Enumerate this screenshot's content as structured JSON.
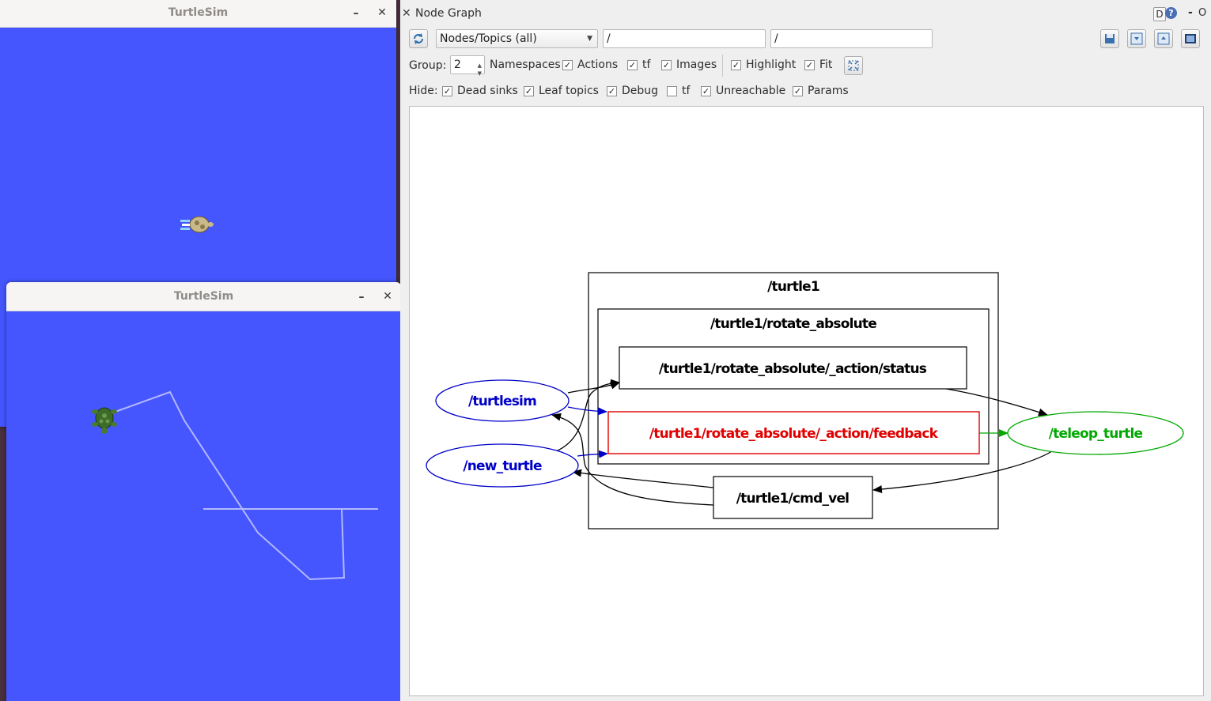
{
  "turtlesim_window_1": {
    "title": "TurtleSim",
    "minimize_glyph": "–",
    "close_glyph": "✕"
  },
  "turtlesim_window_2": {
    "title": "TurtleSim",
    "minimize_glyph": "–",
    "close_glyph": "✕"
  },
  "node_graph": {
    "title": "Node Graph",
    "title_right": {
      "help_label": "D",
      "dash": "-",
      "o": "O"
    },
    "toolbar": {
      "refresh_icon": "refresh-icon",
      "view_select": "Nodes/Topics (all)",
      "filter_1": "/",
      "filter_2": "/",
      "right_icons": [
        "save-icon",
        "load-icon",
        "export-icon",
        "screenshot-icon"
      ]
    },
    "options_row": {
      "group_label": "Group:",
      "group_value": "2",
      "checks": [
        {
          "label": "Namespaces",
          "checked": false
        },
        {
          "label": "Actions",
          "checked": true
        },
        {
          "label": "tf",
          "checked": true
        },
        {
          "label": "Images",
          "checked": true
        },
        {
          "label": "Highlight",
          "checked": true
        },
        {
          "label": "Fit",
          "checked": true
        }
      ]
    },
    "hide_row": {
      "hide_label": "Hide:",
      "checks": [
        {
          "label": "Dead sinks",
          "checked": true
        },
        {
          "label": "Leaf topics",
          "checked": true
        },
        {
          "label": "Debug",
          "checked": true
        },
        {
          "label": "tf",
          "checked": false
        },
        {
          "label": "Unreachable",
          "checked": true
        },
        {
          "label": "Params",
          "checked": true
        }
      ]
    },
    "graph": {
      "cluster_outer": "/turtle1",
      "cluster_inner": "/turtle1/rotate_absolute",
      "topics": {
        "status": "/turtle1/rotate_absolute/_action/status",
        "feedback": "/turtle1/rotate_absolute/_action/feedback",
        "cmd_vel": "/turtle1/cmd_vel"
      },
      "nodes": {
        "turtlesim": "/turtlesim",
        "new_turtle": "/new_turtle",
        "teleop": "/teleop_turtle"
      },
      "colors": {
        "node_blue": "#0000c8",
        "highlight_red": "#e00000",
        "teleop_green": "#00a800",
        "black": "#000000"
      }
    }
  }
}
